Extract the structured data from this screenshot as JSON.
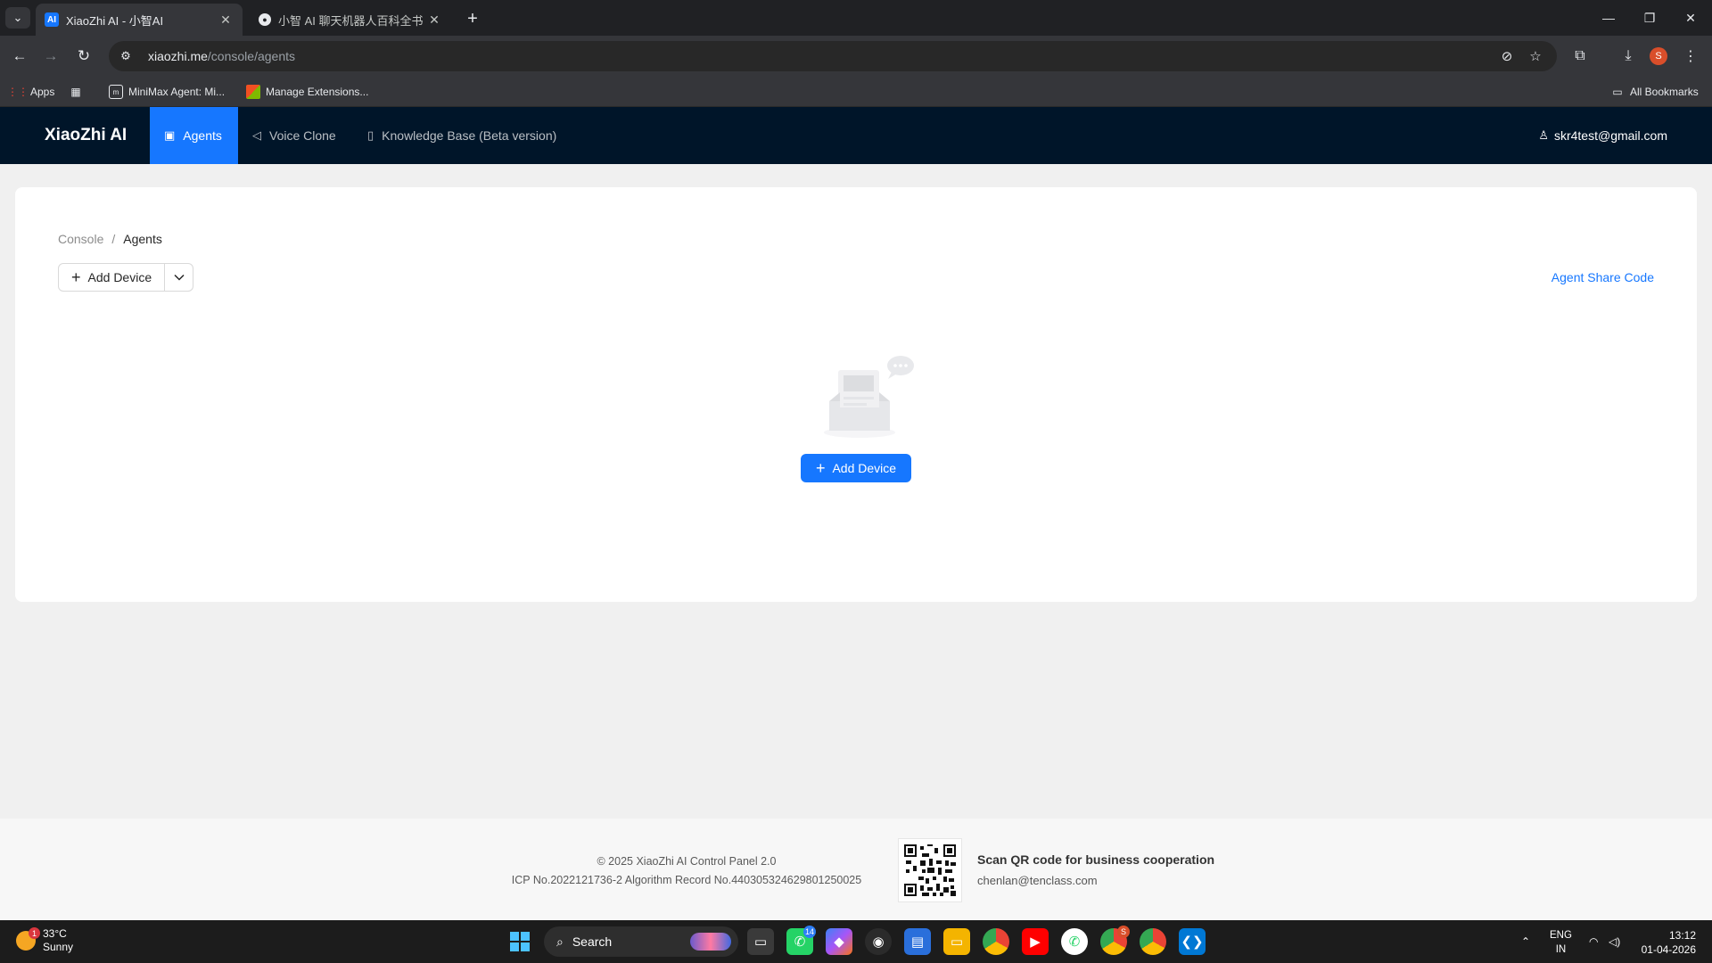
{
  "browser": {
    "tabs": [
      {
        "title": "XiaoZhi AI - 小智AI",
        "favicon": "AI",
        "active": true
      },
      {
        "title": "小智 AI 聊天机器人百科全书 - F",
        "favicon": "bot-icon",
        "active": false
      }
    ],
    "url": {
      "host": "xiaozhi.me",
      "path": "/console/agents"
    },
    "profile_initial": "S",
    "bookmarks": [
      {
        "label": "Apps",
        "icon": "apps-grid-icon"
      },
      {
        "label": "",
        "icon": "tab-groups-icon"
      },
      {
        "label": "MiniMax Agent: Mi...",
        "icon": "minimax-icon"
      },
      {
        "label": "Manage Extensions...",
        "icon": "extensions-icon"
      }
    ],
    "all_bookmarks_label": "All Bookmarks"
  },
  "header": {
    "logo": "XiaoZhi AI",
    "menu": [
      {
        "label": "Agents",
        "icon": "robot-icon",
        "active": true
      },
      {
        "label": "Voice Clone",
        "icon": "speaker-icon",
        "active": false
      },
      {
        "label": "Knowledge Base (Beta version)",
        "icon": "book-icon",
        "active": false
      }
    ],
    "user_email": "skr4test@gmail.com"
  },
  "content": {
    "breadcrumb": {
      "root": "Console",
      "separator": "/",
      "current": "Agents"
    },
    "add_device_label": "Add Device",
    "agent_share_code_label": "Agent Share Code",
    "empty_add_device_label": "Add Device"
  },
  "footer": {
    "copyright": "© 2025 XiaoZhi AI Control Panel 2.0",
    "icp": "ICP No.2022121736-2 Algorithm Record No.440305324629801250025",
    "qr_title": "Scan QR code for business cooperation",
    "qr_email": "chenlan@tenclass.com"
  },
  "taskbar": {
    "weather_temp": "33°C",
    "weather_desc": "Sunny",
    "weather_badge": "1",
    "search_label": "Search",
    "whatsapp_badge": "14",
    "chrome_badge": "S",
    "lang_top": "ENG",
    "lang_bottom": "IN",
    "time": "13:12",
    "date": "01-04-2026"
  },
  "colors": {
    "primary": "#1677ff",
    "header_bg": "#001529",
    "page_bg": "#f0f0f0"
  }
}
